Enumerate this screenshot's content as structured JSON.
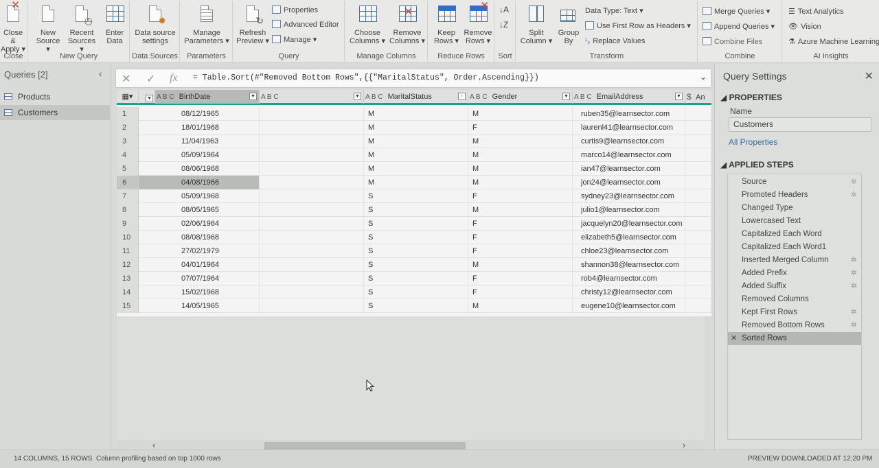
{
  "ribbon": {
    "groups": {
      "close": "Close",
      "new_query": "New Query",
      "data_sources": "Data Sources",
      "parameters": "Parameters",
      "query": "Query",
      "manage_columns": "Manage Columns",
      "reduce_rows": "Reduce Rows",
      "sort": "Sort",
      "transform": "Transform",
      "combine": "Combine",
      "ai_insights": "AI Insights"
    },
    "close_apply": [
      "Close &",
      "Apply ▾"
    ],
    "new_source": [
      "New",
      "Source ▾"
    ],
    "recent_sources": [
      "Recent",
      "Sources ▾"
    ],
    "enter_data": [
      "Enter",
      "Data"
    ],
    "data_source_settings": [
      "Data source",
      "settings"
    ],
    "manage_parameters": [
      "Manage",
      "Parameters ▾"
    ],
    "refresh_preview": [
      "Refresh",
      "Preview ▾"
    ],
    "properties": "Properties",
    "advanced_editor": "Advanced Editor",
    "manage": "Manage ▾",
    "choose_columns": [
      "Choose",
      "Columns ▾"
    ],
    "remove_columns": [
      "Remove",
      "Columns ▾"
    ],
    "keep_rows": [
      "Keep",
      "Rows ▾"
    ],
    "remove_rows": [
      "Remove",
      "Rows ▾"
    ],
    "split_column": [
      "Split",
      "Column ▾"
    ],
    "group_by": [
      "Group",
      "By"
    ],
    "data_type": "Data Type: Text ▾",
    "first_row_headers": "Use First Row as Headers ▾",
    "replace_values": "Replace Values",
    "merge_queries": "Merge Queries ▾",
    "append_queries": "Append Queries ▾",
    "combine_files": "Combine Files",
    "text_analytics": "Text Analytics",
    "vision": "Vision",
    "azure_ml": "Azure Machine Learning"
  },
  "queries": {
    "header": "Queries [2]",
    "items": [
      {
        "label": "Products",
        "selected": false
      },
      {
        "label": "Customers",
        "selected": true
      }
    ]
  },
  "formula": {
    "text": "= Table.Sort(#\"Removed Bottom Rows\",{{\"MaritalStatus\", Order.Ascending}})"
  },
  "grid": {
    "columns": {
      "birthdate": {
        "type": "A B C",
        "label": "BirthDate"
      },
      "middle": {
        "type": "A B C",
        "label": ""
      },
      "marital": {
        "type": "A B C",
        "label": "MaritalStatus"
      },
      "gender": {
        "type": "A B C",
        "label": "Gender"
      },
      "email": {
        "type": "A B C",
        "label": "EmailAddress"
      },
      "next": {
        "type": "$",
        "label": "An"
      }
    },
    "rows": [
      {
        "n": "1",
        "birthdate": "08/12/1965",
        "marital": "M",
        "gender": "M",
        "email": "ruben35@learnsector.com"
      },
      {
        "n": "2",
        "birthdate": "18/01/1968",
        "marital": "M",
        "gender": "F",
        "email": "laurenl41@learnsector.com"
      },
      {
        "n": "3",
        "birthdate": "11/04/1963",
        "marital": "M",
        "gender": "M",
        "email": "curtis9@learnsector.com"
      },
      {
        "n": "4",
        "birthdate": "05/09/1964",
        "marital": "M",
        "gender": "M",
        "email": "marco14@learnsector.com"
      },
      {
        "n": "5",
        "birthdate": "08/06/1968",
        "marital": "M",
        "gender": "M",
        "email": "ian47@learnsector.com"
      },
      {
        "n": "6",
        "birthdate": "04/08/1966",
        "marital": "M",
        "gender": "M",
        "email": "jon24@learnsector.com"
      },
      {
        "n": "7",
        "birthdate": "05/09/1968",
        "marital": "S",
        "gender": "F",
        "email": "sydney23@learnsector.com"
      },
      {
        "n": "8",
        "birthdate": "08/05/1965",
        "marital": "S",
        "gender": "M",
        "email": "julio1@learnsector.com"
      },
      {
        "n": "9",
        "birthdate": "02/06/1964",
        "marital": "S",
        "gender": "F",
        "email": "jacquelyn20@learnsector.com"
      },
      {
        "n": "10",
        "birthdate": "08/08/1968",
        "marital": "S",
        "gender": "F",
        "email": "elizabeth5@learnsector.com"
      },
      {
        "n": "11",
        "birthdate": "27/02/1979",
        "marital": "S",
        "gender": "F",
        "email": "chloe23@learnsector.com"
      },
      {
        "n": "12",
        "birthdate": "04/01/1964",
        "marital": "S",
        "gender": "M",
        "email": "shannon38@learnsector.com"
      },
      {
        "n": "13",
        "birthdate": "07/07/1964",
        "marital": "S",
        "gender": "F",
        "email": "rob4@learnsector.com"
      },
      {
        "n": "14",
        "birthdate": "15/02/1968",
        "marital": "S",
        "gender": "F",
        "email": "christy12@learnsector.com"
      },
      {
        "n": "15",
        "birthdate": "14/05/1965",
        "marital": "S",
        "gender": "M",
        "email": "eugene10@learnsector.com"
      }
    ]
  },
  "settings": {
    "title": "Query Settings",
    "properties_header": "PROPERTIES",
    "name_label": "Name",
    "name_value": "Customers",
    "all_properties": "All Properties",
    "steps_header": "APPLIED STEPS",
    "steps": [
      {
        "label": "Source",
        "gear": true
      },
      {
        "label": "Promoted Headers",
        "gear": true
      },
      {
        "label": "Changed Type",
        "gear": false
      },
      {
        "label": "Lowercased Text",
        "gear": false
      },
      {
        "label": "Capitalized Each Word",
        "gear": false
      },
      {
        "label": "Capitalized Each Word1",
        "gear": false
      },
      {
        "label": "Inserted Merged Column",
        "gear": true
      },
      {
        "label": "Added Prefix",
        "gear": true
      },
      {
        "label": "Added Suffix",
        "gear": true
      },
      {
        "label": "Removed Columns",
        "gear": false
      },
      {
        "label": "Kept First Rows",
        "gear": true
      },
      {
        "label": "Removed Bottom Rows",
        "gear": true
      },
      {
        "label": "Sorted Rows",
        "gear": false,
        "selected": true
      }
    ]
  },
  "status": {
    "columns_rows": "14 COLUMNS, 15 ROWS",
    "profiling": "Column profiling based on top 1000 rows",
    "preview": "PREVIEW DOWNLOADED AT 12:20 PM"
  },
  "colors": {
    "accent": "#17a58a",
    "link": "#3c6aa6"
  }
}
